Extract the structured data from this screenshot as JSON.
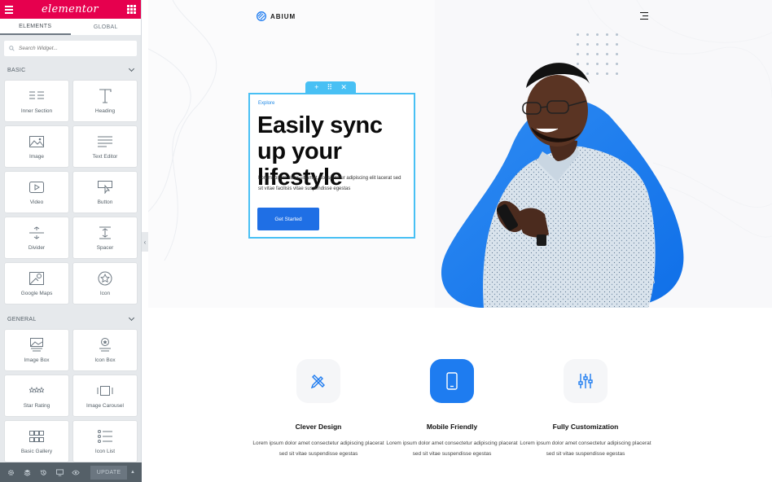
{
  "sidebar": {
    "logo": "elementor",
    "tabs": [
      {
        "label": "ELEMENTS"
      },
      {
        "label": "GLOBAL"
      }
    ],
    "search": {
      "placeholder": "Search Widget..."
    },
    "categories": [
      {
        "label": "BASIC",
        "widgets": [
          {
            "label": "Inner Section",
            "icon": "inner-section-icon"
          },
          {
            "label": "Heading",
            "icon": "heading-icon"
          },
          {
            "label": "Image",
            "icon": "image-icon"
          },
          {
            "label": "Text Editor",
            "icon": "text-editor-icon"
          },
          {
            "label": "Video",
            "icon": "video-icon"
          },
          {
            "label": "Button",
            "icon": "button-icon"
          },
          {
            "label": "Divider",
            "icon": "divider-icon"
          },
          {
            "label": "Spacer",
            "icon": "spacer-icon"
          },
          {
            "label": "Google Maps",
            "icon": "google-maps-icon"
          },
          {
            "label": "Icon",
            "icon": "star-circle-icon"
          }
        ]
      },
      {
        "label": "GENERAL",
        "widgets": [
          {
            "label": "Image Box",
            "icon": "image-box-icon"
          },
          {
            "label": "Icon Box",
            "icon": "icon-box-icon"
          },
          {
            "label": "Star Rating",
            "icon": "star-rating-icon"
          },
          {
            "label": "Image Carousel",
            "icon": "image-carousel-icon"
          },
          {
            "label": "Basic Gallery",
            "icon": "basic-gallery-icon"
          },
          {
            "label": "Icon List",
            "icon": "icon-list-icon"
          }
        ]
      }
    ],
    "footer": {
      "update_label": "UPDATE"
    }
  },
  "page": {
    "brand": "ABIUM",
    "hero": {
      "eyebrow": "Explore",
      "title": "Easily sync up your lifestyle",
      "body": "Lorem ipsum dolor sit amet, consectetur adipiscing elit lacerat sed sit vitae facilisis vitae suspendisse egestas",
      "cta": "Get Started"
    },
    "features": [
      {
        "title": "Clever Design",
        "text": "Lorem ipsum dolor amet consectetur adipiscing placerat sed sit vitae suspendisse egestas",
        "icon": "pencil-ruler-icon",
        "active": false
      },
      {
        "title": "Mobile Friendly",
        "text": "Lorem ipsum dolor amet consectetur adipiscing placerat sed sit vitae suspendisse egestas",
        "icon": "mobile-icon",
        "active": true
      },
      {
        "title": "Fully Customization",
        "text": "Lorem ipsum dolor amet consectetur adipiscing placerat sed sit vitae suspendisse egestas",
        "icon": "sliders-icon",
        "active": false
      }
    ]
  },
  "colors": {
    "brand_pink": "#e6004e",
    "accent_blue": "#1f6fe5",
    "selection_blue": "#48c0f4"
  }
}
